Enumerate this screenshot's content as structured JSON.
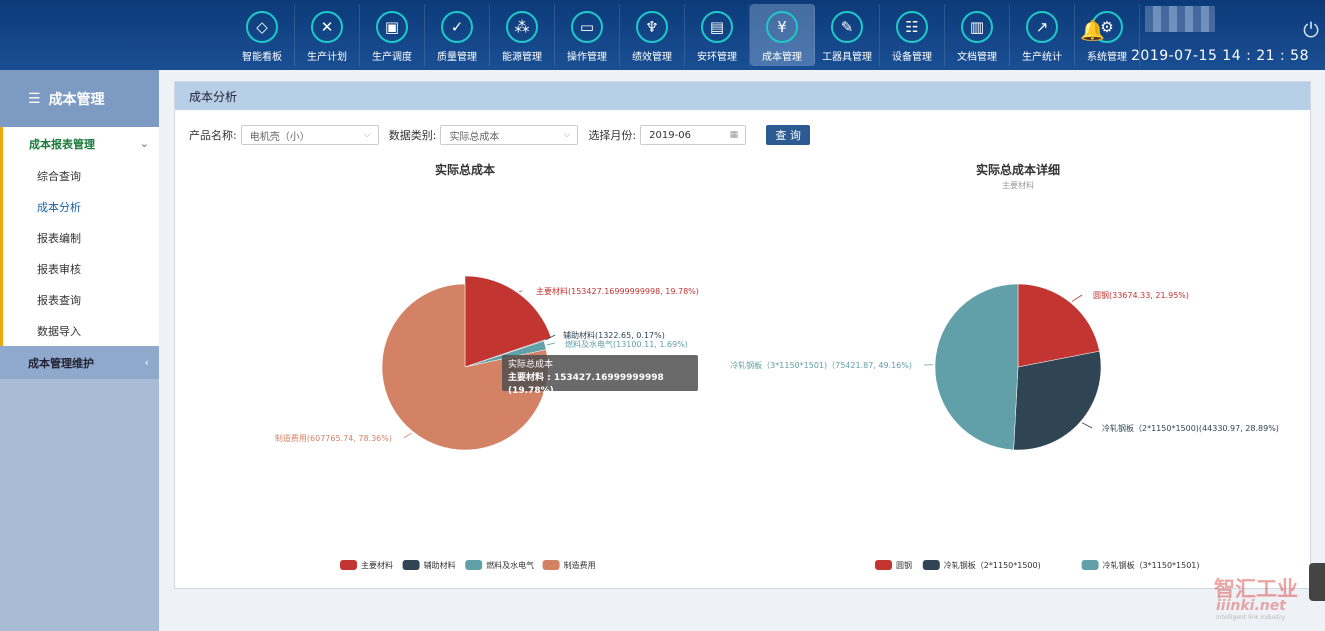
{
  "nav": {
    "items": [
      {
        "label": "智能看板",
        "icon": "diamond-icon",
        "glyph": "◇"
      },
      {
        "label": "生产计划",
        "icon": "tools-icon",
        "glyph": "✕"
      },
      {
        "label": "生产调度",
        "icon": "cube-icon",
        "glyph": "▣"
      },
      {
        "label": "质量管理",
        "icon": "shield-check-icon",
        "glyph": "✓"
      },
      {
        "label": "能源管理",
        "icon": "nodes-icon",
        "glyph": "⁂"
      },
      {
        "label": "操作管理",
        "icon": "monitor-icon",
        "glyph": "▭"
      },
      {
        "label": "绩效管理",
        "icon": "trophy-icon",
        "glyph": "♆"
      },
      {
        "label": "安环管理",
        "icon": "document-lock-icon",
        "glyph": "▤"
      },
      {
        "label": "成本管理",
        "icon": "yen-icon",
        "glyph": "¥"
      },
      {
        "label": "工器具管理",
        "icon": "pencil-ruler-icon",
        "glyph": "✎"
      },
      {
        "label": "设备管理",
        "icon": "router-icon",
        "glyph": "☷"
      },
      {
        "label": "文档管理",
        "icon": "file-icon",
        "glyph": "▥"
      },
      {
        "label": "生产统计",
        "icon": "line-chart-icon",
        "glyph": "↗"
      },
      {
        "label": "系统管理",
        "icon": "gear-icon",
        "glyph": "⚙"
      }
    ],
    "active_index": 8
  },
  "header": {
    "datetime": "2019-07-15 14 : 21 : 58"
  },
  "sidebar": {
    "title": "成本管理",
    "group1": "成本报表管理",
    "items": [
      "综合查询",
      "成本分析",
      "报表编制",
      "报表审核",
      "报表查询",
      "数据导入"
    ],
    "active_item": 1,
    "group2": "成本管理维护"
  },
  "panel": {
    "title": "成本分析"
  },
  "filters": {
    "product_label": "产品名称:",
    "product_value": "电机壳（小）",
    "type_label": "数据类别:",
    "type_value": "实际总成本",
    "month_label": "选择月份:",
    "month_value": "2019-06",
    "query_label": "查 询"
  },
  "tooltip": {
    "title": "实际总成本",
    "text": "主要材料 : 153427.16999999998 (19.78%)"
  },
  "colors": {
    "red": "#c23531",
    "navy": "#2f4554",
    "teal": "#61a0a8",
    "orange": "#d48265"
  },
  "chart_data": [
    {
      "type": "pie",
      "title": "实际总成本",
      "slices": [
        {
          "name": "主要材料",
          "value": 153427.16999999998,
          "percent": 19.78,
          "label": "主要材料(153427.16999999998, 19.78%)",
          "color": "#c23531"
        },
        {
          "name": "辅助材料",
          "value": 1322.65,
          "percent": 0.17,
          "label": "辅助材料(1322.65, 0.17%)",
          "color": "#2f4554"
        },
        {
          "name": "燃料及水电气",
          "value": 13100.11,
          "percent": 1.69,
          "label": "燃料及水电气(13100.11, 1.69%)",
          "color": "#61a0a8"
        },
        {
          "name": "制造费用",
          "value": 607765.74,
          "percent": 78.36,
          "label": "制造费用(607765.74, 78.36%)",
          "color": "#d48265"
        }
      ],
      "legend": [
        "主要材料",
        "辅助材料",
        "燃料及水电气",
        "制造费用"
      ],
      "legend_position": "bottom"
    },
    {
      "type": "pie",
      "title": "实际总成本详细",
      "subtitle": "主要材料",
      "slices": [
        {
          "name": "圆钢",
          "value": 33674.33,
          "percent": 21.95,
          "label": "圆钢(33674.33, 21.95%)",
          "color": "#c23531"
        },
        {
          "name": "冷轧钢板（2*1150*1500)",
          "value": 44330.97,
          "percent": 28.89,
          "label": "冷轧钢板（2*1150*1500)(44330.97, 28.89%)",
          "color": "#2f4554"
        },
        {
          "name": "冷轧钢板（3*1150*1501)",
          "value": 75421.87,
          "percent": 49.16,
          "label": "冷轧钢板（3*1150*1501)（75421.87, 49.16%)",
          "color": "#61a0a8"
        }
      ],
      "legend": [
        "圆钢",
        "冷轧钢板（2*1150*1500)",
        "冷轧钢板（3*1150*1501)"
      ],
      "legend_position": "bottom"
    }
  ],
  "watermark": {
    "brand": "智汇工业",
    "site": "iiinki.net",
    "tag": "intelligent link industry"
  }
}
